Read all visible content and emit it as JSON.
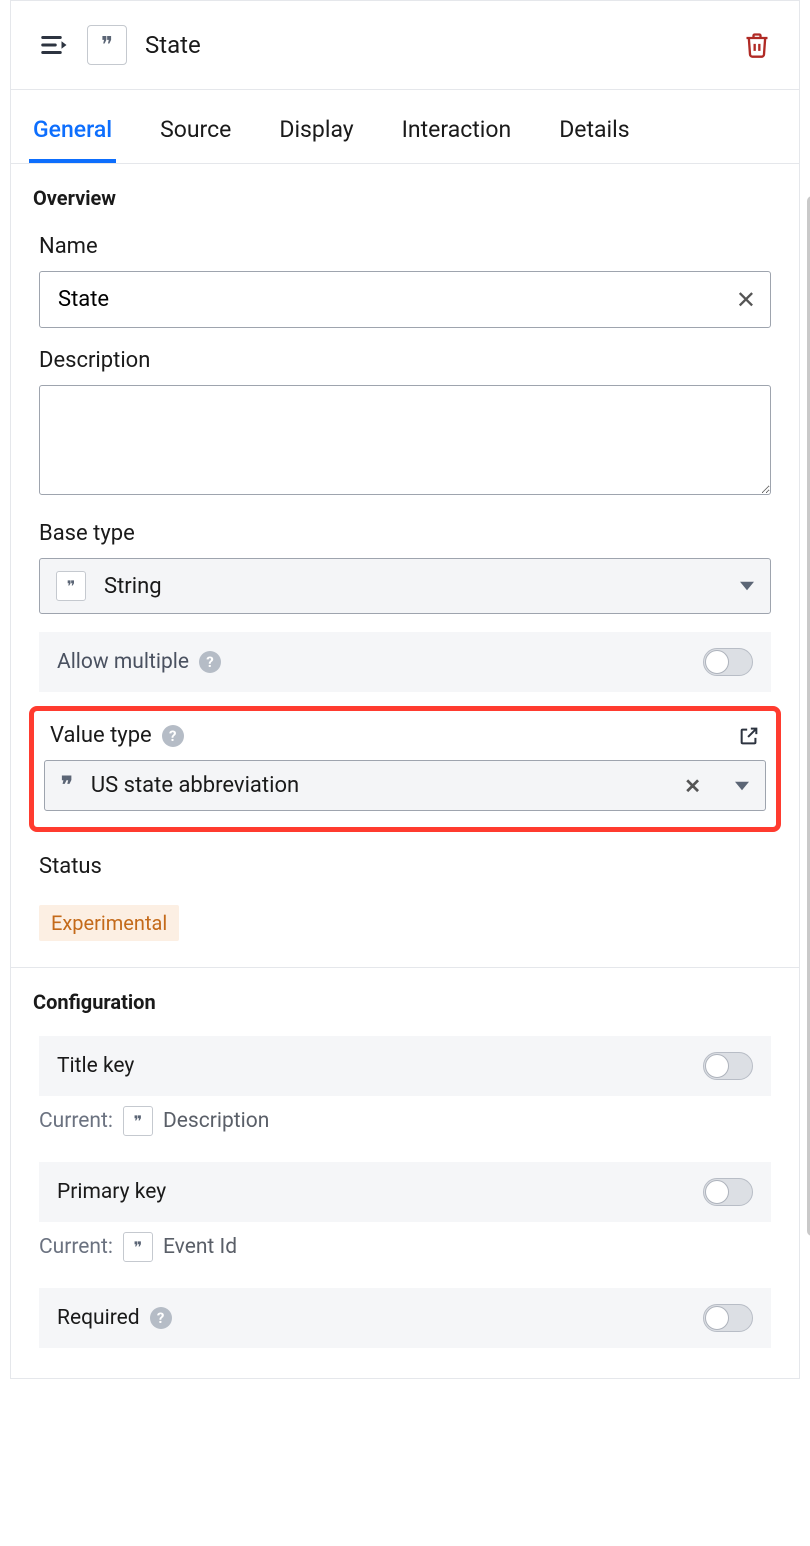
{
  "header": {
    "title": "State"
  },
  "tabs": [
    "General",
    "Source",
    "Display",
    "Interaction",
    "Details"
  ],
  "active_tab": 0,
  "overview": {
    "section_label": "Overview",
    "name_label": "Name",
    "name_value": "State",
    "description_label": "Description",
    "description_value": "",
    "base_type_label": "Base type",
    "base_type_value": "String",
    "allow_multiple_label": "Allow multiple",
    "allow_multiple_on": false,
    "value_type_label": "Value type",
    "value_type_value": "US state abbreviation",
    "status_label": "Status",
    "status_value": "Experimental"
  },
  "configuration": {
    "section_label": "Configuration",
    "title_key_label": "Title key",
    "title_key_on": false,
    "title_key_current_label": "Current:",
    "title_key_current_value": "Description",
    "primary_key_label": "Primary key",
    "primary_key_on": false,
    "primary_key_current_label": "Current:",
    "primary_key_current_value": "Event Id",
    "required_label": "Required",
    "required_on": false
  }
}
